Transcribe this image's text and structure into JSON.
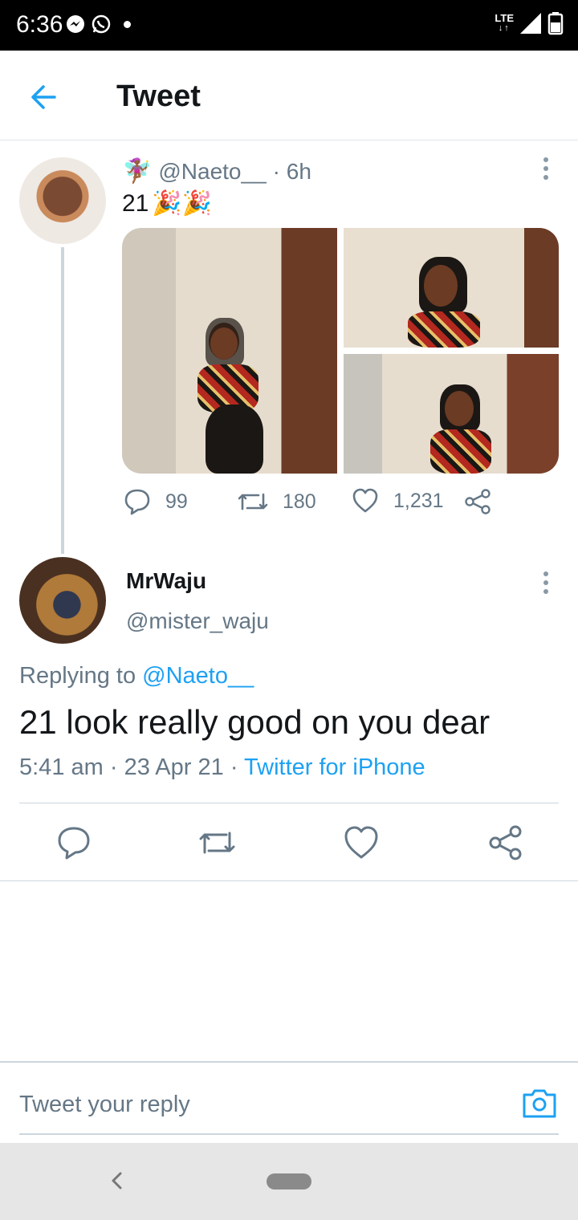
{
  "status_bar": {
    "time": "6:36",
    "network": "LTE",
    "icons": [
      "messenger-icon",
      "whatsapp-icon",
      "notification-dot",
      "signal-icon",
      "battery-icon"
    ]
  },
  "header": {
    "title": "Tweet",
    "back_icon": "arrow-left-icon"
  },
  "original_tweet": {
    "emoji_prefix": "🧚🏾‍♀️",
    "handle": "@Naeto__",
    "time": "· 6h",
    "text": "21",
    "emojis": "🎉🎉",
    "actions": {
      "replies": "99",
      "retweets": "180",
      "likes": "1,231"
    }
  },
  "reply_tweet": {
    "name": "MrWaju",
    "handle": "@mister_waju",
    "replying_prefix": "Replying to",
    "replying_to": "@Naeto__",
    "text": "21 look really good on you dear",
    "time": "5:41 am",
    "date": "23 Apr 21",
    "separator": "·",
    "source": "Twitter for iPhone"
  },
  "reply_box": {
    "placeholder": "Tweet your reply"
  },
  "colors": {
    "accent": "#1da1f2",
    "secondary_text": "#657786",
    "divider": "#ccd6dd"
  }
}
